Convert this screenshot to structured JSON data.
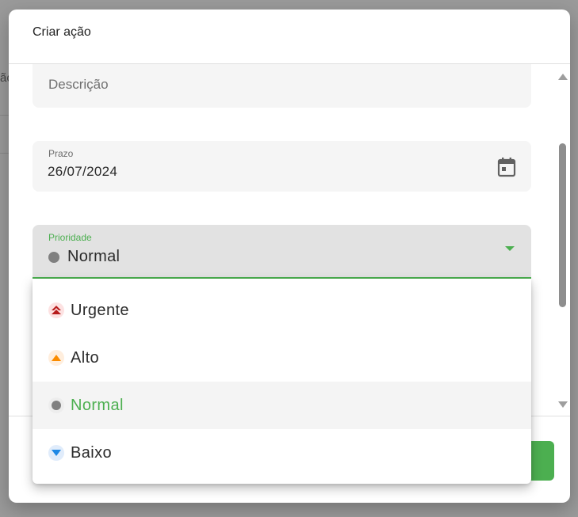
{
  "background": {
    "partial_text": "ão"
  },
  "dialog": {
    "title": "Criar ação",
    "fields": {
      "description": {
        "placeholder": "Descrição"
      },
      "deadline": {
        "label": "Prazo",
        "value": "26/07/2024"
      },
      "priority": {
        "label": "Prioridade",
        "value": "Normal"
      }
    }
  },
  "dropdown": {
    "options": [
      {
        "label": "Urgente",
        "icon": "double-chevron-up-icon",
        "color": "#b71c1c"
      },
      {
        "label": "Alto",
        "icon": "triangle-up-icon",
        "color": "#fb8c00"
      },
      {
        "label": "Normal",
        "icon": "circle-dot-icon",
        "color": "#808080",
        "selected": true
      },
      {
        "label": "Baixo",
        "icon": "triangle-down-icon",
        "color": "#1e88e5"
      }
    ]
  },
  "colors": {
    "accent": "#4caf50"
  }
}
